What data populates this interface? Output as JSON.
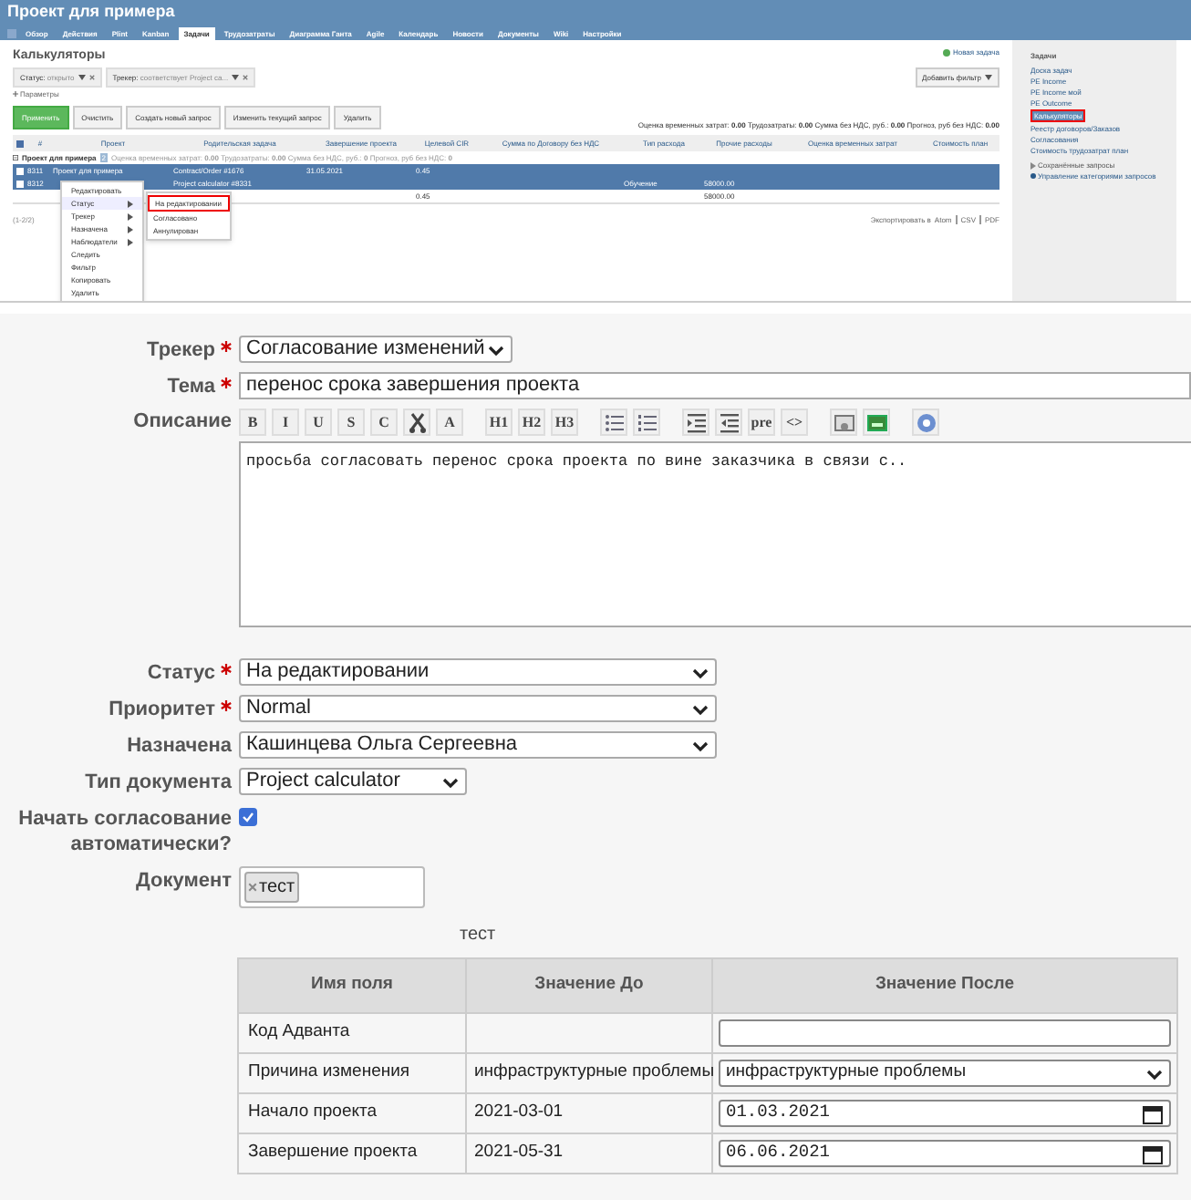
{
  "redmine": {
    "project_title": "Проект для примера",
    "tabs": [
      {
        "label": "Обзор",
        "selected": false
      },
      {
        "label": "Действия",
        "selected": false
      },
      {
        "label": "Plint",
        "selected": false
      },
      {
        "label": "Kanban",
        "selected": false
      },
      {
        "label": "Задачи",
        "selected": true
      },
      {
        "label": "Трудозатраты",
        "selected": false
      },
      {
        "label": "Диаграмма Ганта",
        "selected": false
      },
      {
        "label": "Agile",
        "selected": false
      },
      {
        "label": "Календарь",
        "selected": false
      },
      {
        "label": "Новости",
        "selected": false
      },
      {
        "label": "Документы",
        "selected": false
      },
      {
        "label": "Wiki",
        "selected": false
      },
      {
        "label": "Настройки",
        "selected": false
      }
    ],
    "page_title": "Калькуляторы",
    "new_issue": "Новая задача",
    "filters": [
      {
        "label": "Статус:",
        "value": "открыто"
      },
      {
        "label": "Трекер:",
        "value": "соответствует Project ca..."
      }
    ],
    "add_filter": "Добавить фильтр",
    "params": "Параметры",
    "buttons": [
      {
        "label": "Применить",
        "kind": "primary"
      },
      {
        "label": "Очистить",
        "kind": "plain"
      },
      {
        "label": "Создать новый запрос",
        "kind": "plain"
      },
      {
        "label": "Изменить текущий запрос",
        "kind": "plain"
      },
      {
        "label": "Удалить",
        "kind": "plain"
      }
    ],
    "totals": [
      {
        "label": "Оценка временных затрат:",
        "value": "0.00"
      },
      {
        "label": "Трудозатраты:",
        "value": "0.00"
      },
      {
        "label": "Сумма без НДС, руб.:",
        "value": "0.00"
      },
      {
        "label": "Прогноз, руб без НДС:",
        "value": "0.00"
      }
    ],
    "all_selected": true,
    "columns": [
      "#",
      "Проект",
      "Родительская задача",
      "Завершение проекта",
      "Целевой CIR",
      "Сумма по Договору без НДС",
      "Тип расхода",
      "Прочие расходы",
      "Оценка временных затрат",
      "Стоимость план"
    ],
    "group": {
      "title": "Проект для примера",
      "count": "2",
      "totals": [
        {
          "label": "Оценка временных затрат:",
          "value": "0.00"
        },
        {
          "label": "Трудозатраты:",
          "value": "0.00"
        },
        {
          "label": "Сумма без НДС, руб.:",
          "value": "0"
        },
        {
          "label": "Прогноз, руб без НДС:",
          "value": "0"
        }
      ]
    },
    "rows": [
      {
        "selected": true,
        "id": "8311",
        "project": "Проект для примера",
        "parent": "Contract/Order #1676",
        "end": "31.05.2021",
        "cir": "0.45"
      },
      {
        "selected": true,
        "id": "8312",
        "parent": "Project calculator #8331",
        "type": "Обучение",
        "other": "58000.00"
      }
    ],
    "total_row": {
      "cir": "0.45",
      "other": "58000.00"
    },
    "pagination": "(1-2/2)",
    "context_menu": [
      {
        "label": "Редактировать",
        "submenu": false,
        "selected": false
      },
      {
        "label": "Статус",
        "submenu": true,
        "selected": true
      },
      {
        "label": "Трекер",
        "submenu": true,
        "selected": false
      },
      {
        "label": "Назначена",
        "submenu": true,
        "selected": false
      },
      {
        "label": "Наблюдатели",
        "submenu": true,
        "selected": false
      },
      {
        "label": "Следить",
        "submenu": false,
        "selected": false
      },
      {
        "label": "Фильтр",
        "submenu": false,
        "selected": false
      },
      {
        "label": "Копировать",
        "submenu": false,
        "selected": false
      },
      {
        "label": "Удалить",
        "submenu": false,
        "selected": false
      }
    ],
    "submenu": [
      {
        "label": "На редактировании",
        "selected": true
      },
      {
        "label": "Согласовано",
        "selected": false
      },
      {
        "label": "Аннулирован",
        "selected": false
      }
    ],
    "export": {
      "label": "Экспортировать в",
      "formats": [
        "Atom",
        "CSV",
        "PDF"
      ]
    },
    "sidebar": {
      "title": "Задачи",
      "links": [
        {
          "label": "Доска задач",
          "selected": false
        },
        {
          "label": "PE Income",
          "selected": false
        },
        {
          "label": "PE Income мой",
          "selected": false
        },
        {
          "label": "PE Outcome",
          "selected": false
        },
        {
          "label": "Калькуляторы",
          "selected": true
        },
        {
          "label": "Реестр договоров/Заказов",
          "selected": false
        },
        {
          "label": "Согласования",
          "selected": false
        },
        {
          "label": "Стоимость трудозатрат план",
          "selected": false
        }
      ],
      "saved": "Сохранённые запросы",
      "manage": "Управление категориями запросов"
    }
  },
  "form": {
    "fields": [
      {
        "label": "Трекер",
        "required": true,
        "kind": "select",
        "value": "Согласование изменений"
      },
      {
        "label": "Тема",
        "required": true,
        "kind": "input",
        "value": "перенос срока завершения проекта"
      }
    ],
    "description": {
      "label": "Описание",
      "text": "просьба согласовать перенос срока проекта по вине заказчика в связи с..",
      "toolbar": [
        {
          "kind": "text",
          "label": "B"
        },
        {
          "kind": "text",
          "label": "I"
        },
        {
          "kind": "text",
          "label": "U"
        },
        {
          "kind": "text",
          "label": "S"
        },
        {
          "kind": "text",
          "label": "C"
        },
        {
          "kind": "icon"
        },
        {
          "kind": "text",
          "label": "A"
        },
        {
          "kind": "gap"
        },
        {
          "kind": "text",
          "label": "H1"
        },
        {
          "kind": "text",
          "label": "H2"
        },
        {
          "kind": "text",
          "label": "H3"
        },
        {
          "kind": "gap"
        },
        {
          "kind": "icon"
        },
        {
          "kind": "icon"
        },
        {
          "kind": "gap"
        },
        {
          "kind": "icon"
        },
        {
          "kind": "icon"
        },
        {
          "kind": "text",
          "label": "pre"
        },
        {
          "kind": "text",
          "label": "<>"
        },
        {
          "kind": "gap"
        },
        {
          "kind": "icon"
        },
        {
          "kind": "icon"
        },
        {
          "kind": "gap"
        },
        {
          "kind": "icon"
        }
      ]
    },
    "fields2": [
      {
        "label": "Статус",
        "required": true,
        "kind": "select",
        "value": "На редактировании"
      },
      {
        "label": "Приоритет",
        "required": true,
        "kind": "select",
        "value": "Normal"
      },
      {
        "label": "Назначена",
        "required": false,
        "kind": "select",
        "value": "Кашинцева Ольга Сергеевна"
      },
      {
        "label": "Тип документа",
        "required": false,
        "kind": "select",
        "value": "Project calculator"
      },
      {
        "label": "Начать согласование автоматически?",
        "required": false,
        "kind": "checkbox",
        "checked": true
      },
      {
        "label": "Документ",
        "required": false,
        "kind": "tags",
        "tags": [
          "тест"
        ]
      }
    ],
    "caption": "тест",
    "changes": {
      "columns": [
        "Имя поля",
        "Значение До",
        "Значение После"
      ],
      "rows": [
        {
          "name": "Код Адванта",
          "kind": "input"
        },
        {
          "name": "Причина изменения",
          "before": "инфраструктурные проблемы",
          "kind": "select",
          "after": "инфраструктурные проблемы"
        },
        {
          "name": "Начало проекта",
          "before": "2021-03-01",
          "kind": "date",
          "after": "01.03.2021"
        },
        {
          "name": "Завершение проекта",
          "before": "2021-05-31",
          "kind": "date",
          "after": "06.06.2021"
        }
      ]
    }
  }
}
